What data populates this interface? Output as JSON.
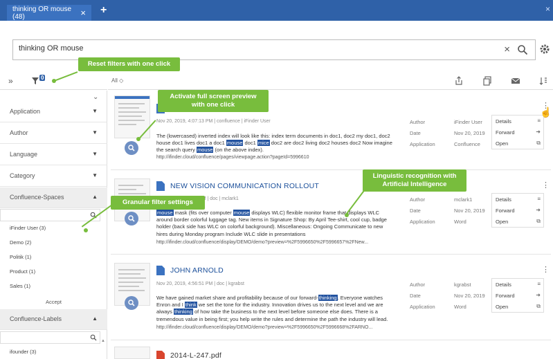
{
  "tabs": [
    {
      "label": "thinking OR mouse (48)"
    }
  ],
  "search": {
    "value": "thinking OR mouse"
  },
  "left": {
    "filter_count": "0",
    "facets": [
      "Application",
      "Author",
      "Language",
      "Category",
      "Confluence-Spaces"
    ],
    "spaces_values": [
      "iFinder User (3)",
      "Demo (2)",
      "Politik (1)",
      "Product (1)",
      "Sales (1)"
    ],
    "accept_label": "Accept",
    "labels_facet": "Confluence-Labels",
    "labels_values": [
      "ifounder (3)"
    ]
  },
  "results_header": {
    "all_label": "All ◇"
  },
  "callouts": {
    "reset": "Reset filters with one click",
    "preview": "Activate full screen preview\nwith one click",
    "linguistic": "Linguistic recognition with\nArtificial Intelligence",
    "granular": "Granular filter settings"
  },
  "meta_labels": {
    "author": "Author",
    "date": "Date",
    "application": "Application"
  },
  "actions": [
    "Details",
    "Forward",
    "Open"
  ],
  "results": [
    {
      "title": "",
      "meta": "Nov 20, 2019, 4:07:13 PM  |  confluence  |  iFinder User",
      "snippet_1": "The (lowercased) inverted index will look like this: index term documents in doc1, doc2 my doc1, doc2",
      "snippet_2a": "house doc1 lives doc1 a doc1 ",
      "hl_a": "mouse",
      "snippet_2b": " doc1 ",
      "hl_b": "mice",
      "snippet_2c": " doc2 are doc2 living doc2 houses doc2 Now imagine",
      "snippet_3a": "the search query ",
      "hl_c": "mouse",
      "snippet_3b": " (on the above index).",
      "url": "http://ifinder.cloud/confluence/pages/viewpage.action?pageId=5996610",
      "author": "iFinder User",
      "date": "Nov 20, 2019",
      "application": "Confluence"
    },
    {
      "title": "NEW VISION COMMUNICATION ROLLOUT",
      "meta": "Nov 20, 2019, 4:53 PM  |  doc  |  mclark1",
      "snippet_1a": "",
      "hl_0": "mouse",
      "snippet_1b": " mask (fits over computer ",
      "hl_a": "mouse",
      "snippet_1c": " displays WLC) flexible monitor frame that displays WLC",
      "snippet_2": "around border colorful luggage tag. New items in Signature Shop: By April Tee-shirt, cool cup, badge",
      "snippet_3": "holder (back side has WLC on colorful background). Miscellaneous: Ongoing Communicate to new",
      "snippet_4": "hires during Monday program Include WLC slide in presentations",
      "url": "http://ifinder.cloud/confluence/display/DEMO/demo?preview=%2F5996650%2F5996657%2FNew...",
      "author": "mclark1",
      "date": "Nov 20, 2019",
      "application": "Word"
    },
    {
      "title": "JOHN ARNOLD",
      "meta": "Nov 20, 2019, 4:56:51 PM  |  doc  |  kgrabst",
      "snippet_1a": "We have gained market share and profitability because of our forward-",
      "hl_a": "thinking",
      "snippet_1b": ". Everyone watches",
      "snippet_2a": "Enron and I ",
      "hl_b": "think",
      "snippet_2b": " we set the tone for the industry. Innovation drives us to the next level and we are",
      "snippet_3a": "always ",
      "hl_c": "thinking",
      "snippet_3b": " of how take the business to the next level before someone else does. There is a",
      "snippet_4": "tremendous value in being first; you help write the rules and determine the path the industry will lead.",
      "url": "http://ifinder.cloud/confluence/display/DEMO/demo?preview=%2F5996650%2F5996668%2FARNO...",
      "author": "kgrabst",
      "date": "Nov 20, 2019",
      "application": "Word"
    },
    {
      "title": "2014-L-247.pdf"
    }
  ]
}
